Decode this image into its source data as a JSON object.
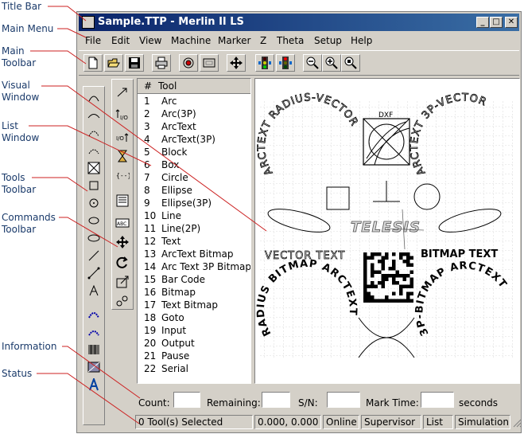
{
  "callouts": {
    "title_bar": "Title Bar",
    "main_menu": "Main Menu",
    "main_toolbar_1": "Main",
    "main_toolbar_2": "Toolbar",
    "visual_window_1": "Visual",
    "visual_window_2": "Window",
    "list_window_1": "List",
    "list_window_2": "Window",
    "tools_toolbar_1": "Tools",
    "tools_toolbar_2": "Toolbar",
    "commands_toolbar_1": "Commands",
    "commands_toolbar_2": "Toolbar",
    "information": "Information",
    "status": "Status"
  },
  "window": {
    "title": "Sample.TTP - Merlin II LS",
    "min_glyph": "_",
    "max_glyph": "□",
    "close_glyph": "✕"
  },
  "menu": {
    "file": "File",
    "edit": "Edit",
    "view": "View",
    "machine": "Machine",
    "marker": "Marker",
    "z": "Z",
    "theta": "Theta",
    "setup": "Setup",
    "help": "Help"
  },
  "list": {
    "col_num": "#",
    "col_tool": "Tool",
    "rows": [
      {
        "n": "1",
        "t": "Arc"
      },
      {
        "n": "2",
        "t": "Arc(3P)"
      },
      {
        "n": "3",
        "t": "ArcText"
      },
      {
        "n": "4",
        "t": "ArcText(3P)"
      },
      {
        "n": "5",
        "t": "Block"
      },
      {
        "n": "6",
        "t": "Box"
      },
      {
        "n": "7",
        "t": "Circle"
      },
      {
        "n": "8",
        "t": "Ellipse"
      },
      {
        "n": "9",
        "t": "Ellipse(3P)"
      },
      {
        "n": "10",
        "t": "Line"
      },
      {
        "n": "11",
        "t": "Line(2P)"
      },
      {
        "n": "12",
        "t": "Text"
      },
      {
        "n": "13",
        "t": "ArcText Bitmap"
      },
      {
        "n": "14",
        "t": "Arc Text 3P Bitmap"
      },
      {
        "n": "15",
        "t": "Bar Code"
      },
      {
        "n": "16",
        "t": "Bitmap"
      },
      {
        "n": "17",
        "t": "Text Bitmap"
      },
      {
        "n": "18",
        "t": "Goto"
      },
      {
        "n": "19",
        "t": "Input"
      },
      {
        "n": "20",
        "t": "Output"
      },
      {
        "n": "21",
        "t": "Pause"
      },
      {
        "n": "22",
        "t": "Serial"
      }
    ]
  },
  "visual": {
    "arctext_left": "ARCTEXT RADIUS-VECTOR",
    "arctext_right": "ARCTEXT 3P-VECTOR",
    "dxf": "DXF",
    "logo": "TELESIS",
    "vector_text": "VECTOR TEXT",
    "bitmap_text": "BITMAP TEXT",
    "radius_bitmap": "RADIUS BITMAP ARCTEXT",
    "threep_bitmap": "3P-BITMAP ARCTEXT"
  },
  "info": {
    "count_label": "Count:",
    "remaining_label": "Remaining:",
    "sn_label": "S/N:",
    "mark_time_label": "Mark Time:",
    "seconds_label": "seconds"
  },
  "status": {
    "selected": "0 Tool(s) Selected",
    "coords": "0.000, 0.000",
    "online": "Online",
    "user": "Supervisor",
    "list": "List",
    "mode": "Simulation"
  }
}
